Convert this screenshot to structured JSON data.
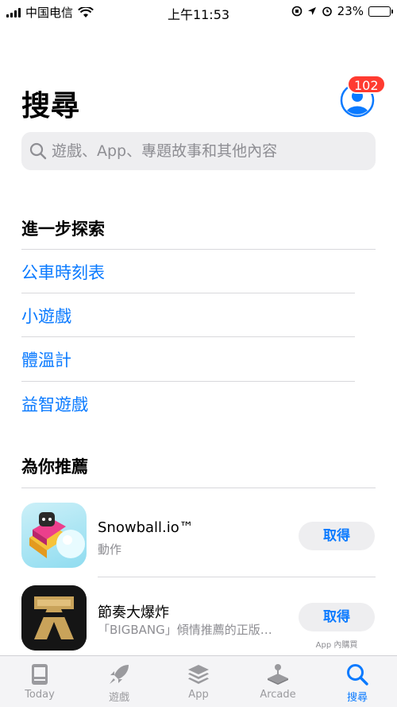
{
  "status_bar": {
    "carrier": "中国电信",
    "time": "上午11:53",
    "battery": "23%",
    "battery_level": 0.23
  },
  "header": {
    "title": "搜尋",
    "badge_count": "102"
  },
  "search": {
    "placeholder": "遊戲、App、專題故事和其他內容"
  },
  "discover": {
    "title": "進一步探索",
    "items": [
      "公車時刻表",
      "小遊戲",
      "體溫計",
      "益智遊戲"
    ]
  },
  "recommended": {
    "title": "為你推薦",
    "apps": [
      {
        "name": "Snowball.io™",
        "subtitle": "動作",
        "button": "取得",
        "note": ""
      },
      {
        "name": "節奏大爆炸",
        "subtitle": "「BIGBANG」傾情推薦的正版…",
        "button": "取得",
        "note": "App 內購買"
      }
    ]
  },
  "tab_bar": {
    "tabs": [
      {
        "label": "Today",
        "icon": "today-icon",
        "active": false
      },
      {
        "label": "遊戲",
        "icon": "rocket-icon",
        "active": false
      },
      {
        "label": "App",
        "icon": "layers-icon",
        "active": false
      },
      {
        "label": "Arcade",
        "icon": "joystick-icon",
        "active": false
      },
      {
        "label": "搜尋",
        "icon": "search-icon",
        "active": true
      }
    ]
  },
  "colors": {
    "accent": "#0a7aff",
    "badge": "#ff3b30",
    "secondary_text": "#8e8e93"
  }
}
